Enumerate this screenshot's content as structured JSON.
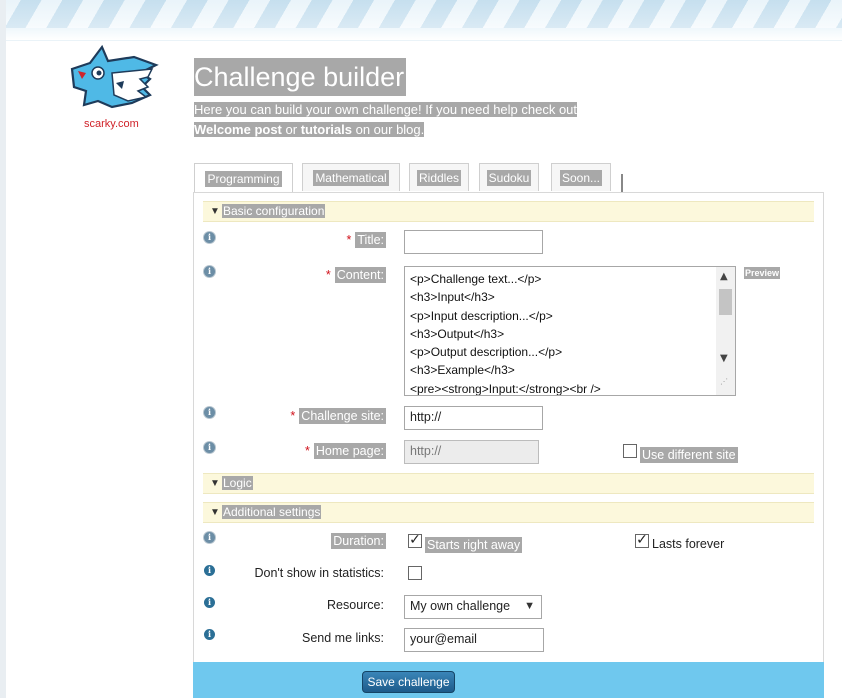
{
  "brand": {
    "logo_text": "scarky.com"
  },
  "page": {
    "title": "Challenge builder",
    "intro_line1": "Here you can build your own challenge! If you need help check out",
    "intro_link1": "Welcome post",
    "intro_or": " or ",
    "intro_link2": "tutorials",
    "intro_end": " on our blog."
  },
  "tabs": [
    {
      "label": "Programming",
      "active": true
    },
    {
      "label": "Mathematical"
    },
    {
      "label": "Riddles"
    },
    {
      "label": "Sudoku"
    },
    {
      "label": "Soon..."
    }
  ],
  "sections": {
    "basic": "Basic configuration",
    "logic": "Logic",
    "additional": "Additional settings"
  },
  "form": {
    "title_label": "Title:",
    "title_value": "",
    "content_label": "Content:",
    "content_lines": [
      "<p>Challenge text...</p>",
      "<h3>Input</h3>",
      "<p>Input description...</p>",
      "<h3>Output</h3>",
      "<p>Output description...</p>",
      "<h3>Example</h3>",
      "<pre><strong>Input:</strong><br />"
    ],
    "preview_label": "Preview",
    "challenge_site_label": "Challenge site:",
    "challenge_site_value": "http://",
    "home_page_label": "Home page:",
    "home_page_value": "http://",
    "use_different_site_label": "Use different site",
    "duration_label": "Duration:",
    "starts_right_away_label": "Starts right away",
    "lasts_forever_label": "Lasts forever",
    "dont_show_label": "Don't show in statistics:",
    "resource_label": "Resource:",
    "resource_value": "My own challenge",
    "send_links_label": "Send me links:",
    "send_links_value": "your@email",
    "required_mark": "*",
    "info_glyph": "i",
    "save_label": "Save challenge"
  },
  "colors": {
    "highlight": "#a8a8a8",
    "section_bg": "#fcf8dc",
    "footer_bg": "#6fc8ee",
    "button_bg": "#1d5b8a",
    "required": "#d0101a"
  }
}
